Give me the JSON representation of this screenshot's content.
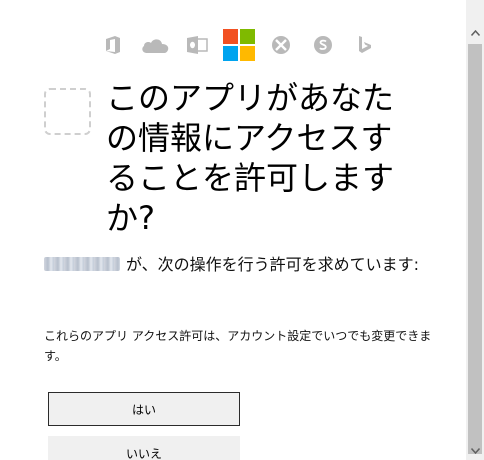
{
  "product_icons": [
    {
      "name": "office-icon",
      "color": "#b9b9b9"
    },
    {
      "name": "onedrive-icon",
      "color": "#b9b9b9"
    },
    {
      "name": "outlook-icon",
      "color": "#b9b9b9"
    },
    {
      "name": "microsoft-logo",
      "colors": [
        "#f25022",
        "#7fba00",
        "#00a4ef",
        "#ffb900"
      ]
    },
    {
      "name": "xbox-icon",
      "color": "#b9b9b9"
    },
    {
      "name": "skype-icon",
      "color": "#b9b9b9"
    },
    {
      "name": "bing-icon",
      "color": "#b9b9b9"
    }
  ],
  "title_lines": [
    "このアプリがあなた",
    "の情報にアクセスす",
    "ることを許可します",
    "か?"
  ],
  "request_text": "が、次の操作を行う許可を求めています:",
  "note_text": "これらのアプリ アクセス許可は、アカウント設定でいつでも変更できます。",
  "buttons": {
    "yes": "はい",
    "no": "いいえ"
  },
  "colors": {
    "button_bg": "#f0f0f0",
    "icon_gray": "#b9b9b9"
  }
}
